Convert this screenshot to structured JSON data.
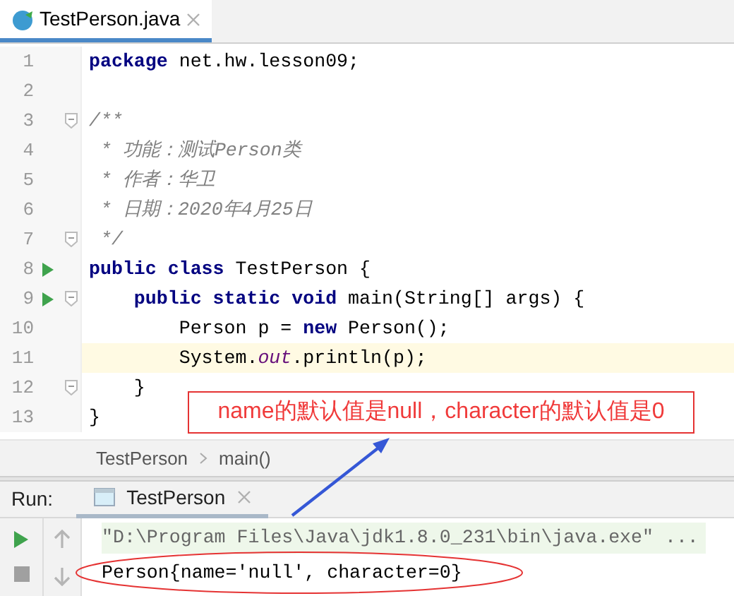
{
  "editor_tab": {
    "title": "TestPerson.java",
    "selected": true
  },
  "code_lines": [
    {
      "number": "1",
      "run": false,
      "fold": false,
      "current": false,
      "tokens": [
        {
          "kind": "keyword",
          "text": "package"
        },
        {
          "kind": "plain",
          "text": " net.hw.lesson09;"
        }
      ]
    },
    {
      "number": "2",
      "run": false,
      "fold": false,
      "current": false
    },
    {
      "number": "3",
      "run": false,
      "fold": true,
      "current": false,
      "tokens": [
        {
          "kind": "comment",
          "text": "/**"
        }
      ]
    },
    {
      "number": "4",
      "run": false,
      "fold": false,
      "current": false,
      "tokens": [
        {
          "kind": "comment",
          "text": " * 功能：测试Person类"
        }
      ]
    },
    {
      "number": "5",
      "run": false,
      "fold": false,
      "current": false,
      "tokens": [
        {
          "kind": "comment",
          "text": " * 作者：华卫"
        }
      ]
    },
    {
      "number": "6",
      "run": false,
      "fold": false,
      "current": false,
      "tokens": [
        {
          "kind": "comment",
          "text": " * 日期：2020年4月25日"
        }
      ]
    },
    {
      "number": "7",
      "run": false,
      "fold": true,
      "current": false,
      "tokens": [
        {
          "kind": "comment",
          "text": " */"
        }
      ]
    },
    {
      "number": "8",
      "run": true,
      "fold": false,
      "current": false,
      "tokens": [
        {
          "kind": "keyword",
          "text": "public class"
        },
        {
          "kind": "plain",
          "text": " TestPerson {"
        }
      ]
    },
    {
      "number": "9",
      "run": true,
      "fold": true,
      "current": false,
      "tokens": [
        {
          "kind": "keyword",
          "text": "    public static void"
        },
        {
          "kind": "plain",
          "text": " main(String[] args) {"
        }
      ]
    },
    {
      "number": "10",
      "run": false,
      "fold": false,
      "current": false,
      "tokens": [
        {
          "kind": "plain",
          "text": "        Person p = "
        },
        {
          "kind": "keyword",
          "text": "new"
        },
        {
          "kind": "plain",
          "text": " Person();"
        }
      ]
    },
    {
      "number": "11",
      "run": false,
      "fold": false,
      "current": true,
      "tokens": [
        {
          "kind": "plain",
          "text": "        System."
        },
        {
          "kind": "static",
          "text": "out"
        },
        {
          "kind": "plain",
          "text": ".println(p);"
        }
      ]
    },
    {
      "number": "12",
      "run": false,
      "fold": true,
      "current": false,
      "tokens": [
        {
          "kind": "plain",
          "text": "    }"
        }
      ]
    },
    {
      "number": "13",
      "run": false,
      "fold": false,
      "current": false,
      "tokens": [
        {
          "kind": "plain",
          "text": "}"
        }
      ]
    }
  ],
  "breadcrumb": [
    "TestPerson",
    "main()"
  ],
  "run_panel": {
    "label": "Run:",
    "tab": {
      "title": "TestPerson",
      "selected": true
    },
    "console": [
      {
        "kind": "command",
        "text": "\"D:\\Program Files\\Java\\jdk1.8.0_231\\bin\\java.exe\" ..."
      },
      {
        "kind": "output",
        "text": "Person{name='null', character=0}"
      }
    ]
  },
  "annotation": {
    "text": "name的默认值是null，character的默认值是0"
  }
}
